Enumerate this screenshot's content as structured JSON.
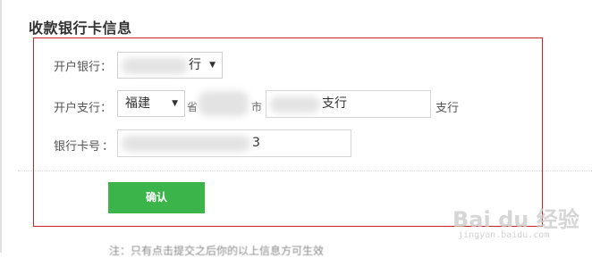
{
  "section_title": "收款银行卡信息",
  "form": {
    "bank_label": "开户银行：",
    "bank_select_value": "行",
    "branch_label": "开户支行：",
    "province_value": "福建",
    "province_suffix": "省",
    "city_suffix": "市",
    "branch_input_value": "支行",
    "branch_suffix": "支行",
    "card_label": "银行卡号",
    "card_separator": "：",
    "card_input_value": "3"
  },
  "confirm_label": "确认",
  "note_text": "注：只有点击提交之后你的以上信息方可生效",
  "watermark": {
    "text": "Bai du 经验",
    "url": "jingyan.baidu.com"
  },
  "colors": {
    "highlight_border": "#c8232c",
    "confirm_button": "#3bb54a"
  }
}
